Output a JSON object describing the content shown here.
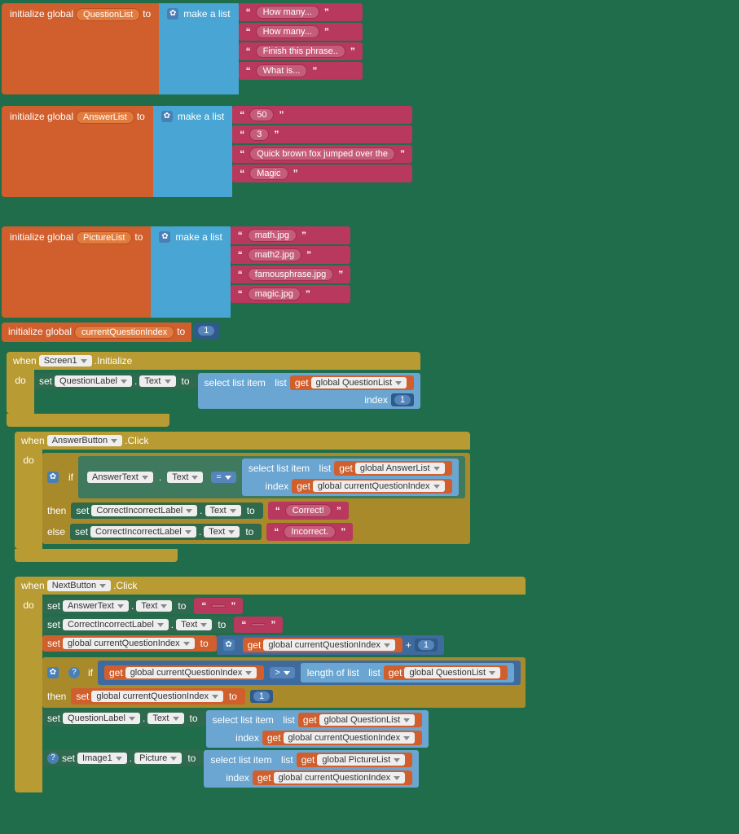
{
  "keywords": {
    "initGlobal": "initialize global",
    "to": "to",
    "makeList": "make a list",
    "when": "when",
    "do": "do",
    "set": "set",
    "get": "get",
    "if": "if",
    "then": "then",
    "else": "else",
    "selectListItem": "select list item",
    "list": "list",
    "index": "index",
    "lengthOfList": "length of list",
    "text": "Text",
    "picture": "Picture",
    "initialize": ".Initialize",
    "click": ".Click"
  },
  "ops": {
    "eq": "=",
    "gt": ">",
    "plus": "+"
  },
  "vars": {
    "questionList": "QuestionList",
    "answerList": "AnswerList",
    "pictureList": "PictureList",
    "currentQI": "currentQuestionIndex",
    "globalQuestionList": "global QuestionList",
    "globalAnswerList": "global AnswerList",
    "globalPictureList": "global PictureList",
    "globalCQI": "global currentQuestionIndex"
  },
  "components": {
    "screen1": "Screen1",
    "questionLabel": "QuestionLabel",
    "answerButton": "AnswerButton",
    "answerText": "AnswerText",
    "correctLabel": "CorrectIncorrectLabel",
    "nextButton": "NextButton",
    "image1": "Image1"
  },
  "lists": {
    "questions": [
      "How many...",
      "How many...",
      "Finish this phrase..",
      "What is..."
    ],
    "answers": [
      "50",
      "3",
      "Quick brown fox jumped over the",
      "Magic"
    ],
    "pictures": [
      "math.jpg",
      "math2.jpg",
      "famousphrase.jpg",
      "magic.jpg"
    ]
  },
  "numbers": {
    "one": "1"
  },
  "strings": {
    "correct": "Correct!",
    "incorrect": "Incorrect.",
    "blank": " "
  }
}
